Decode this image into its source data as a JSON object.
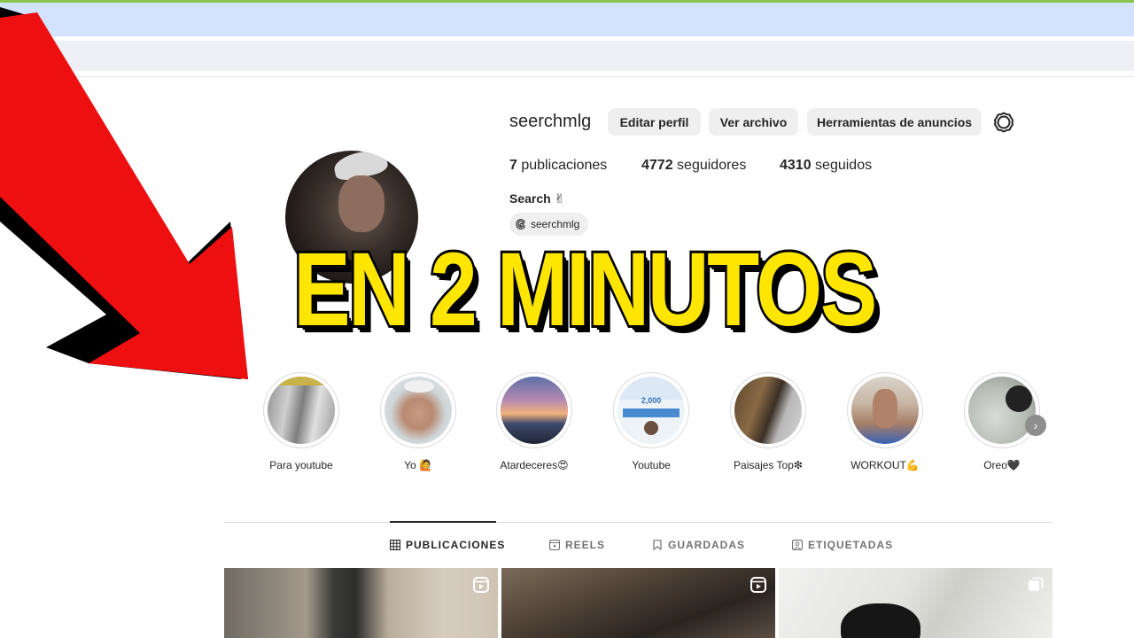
{
  "profile": {
    "username": "seerchmlg",
    "buttons": {
      "edit": "Editar perfil",
      "archive": "Ver archivo",
      "ads": "Herramientas de anuncios"
    },
    "stats": {
      "posts_count": "7",
      "posts_label": " publicaciones",
      "followers_count": "4772",
      "followers_label": " seguidores",
      "following_count": "4310",
      "following_label": " seguidos"
    },
    "full_name": "Search ✌",
    "threads_handle": "seerchmlg"
  },
  "overlay": {
    "headline": "EN 2 MINUTOS",
    "arrow_color": "#ee1010",
    "text_color": "#ffe600"
  },
  "highlights": [
    {
      "label": "Para youtube"
    },
    {
      "label": "Yo 🙋"
    },
    {
      "label": "Atardeceres😍"
    },
    {
      "label": "Youtube",
      "inner_text": "2,000"
    },
    {
      "label": "Paisajes Top❇"
    },
    {
      "label": "WORKOUT💪"
    },
    {
      "label": "Oreo🖤"
    }
  ],
  "tabs": [
    {
      "label": "PUBLICACIONES",
      "icon": "grid-icon",
      "active": true
    },
    {
      "label": "REELS",
      "icon": "reels-icon",
      "active": false
    },
    {
      "label": "GUARDADAS",
      "icon": "bookmark-icon",
      "active": false
    },
    {
      "label": "ETIQUETADAS",
      "icon": "tagged-icon",
      "active": false
    }
  ],
  "posts": [
    {
      "type": "reel",
      "icon": "reel-icon"
    },
    {
      "type": "reel",
      "icon": "reel-icon"
    },
    {
      "type": "carousel",
      "icon": "carousel-icon"
    }
  ]
}
